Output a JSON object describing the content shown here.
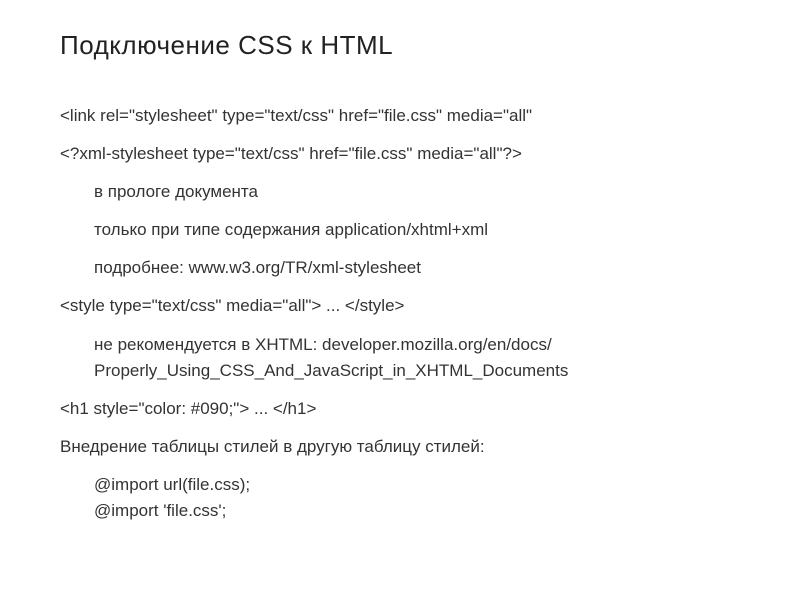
{
  "title": "Подключение CSS к HTML",
  "lines": [
    {
      "text": "<link rel=\"stylesheet\" type=\"text/css\" href=\"file.css\" media=\"all\"",
      "indent": false
    },
    {
      "text": "<?xml-stylesheet type=\"text/css\" href=\"file.css\" media=\"all\"?>",
      "indent": false
    },
    {
      "text": "в прологе документа",
      "indent": true
    },
    {
      "text": "только при типе содержания application/xhtml+xml",
      "indent": true
    },
    {
      "text": "подробнее: www.w3.org/TR/xml-stylesheet",
      "indent": true
    },
    {
      "text": "<style type=\"text/css\" media=\"all\"> ... </style>",
      "indent": false
    },
    {
      "text": "не рекомендуется в XHTML: developer.mozilla.org/en/docs/",
      "indent": true,
      "tight": true
    },
    {
      "text": "Properly_Using_CSS_And_JavaScript_in_XHTML_Documents",
      "indent": true
    },
    {
      "text": "<h1 style=\"color: #090;\"> ... </h1>",
      "indent": false
    },
    {
      "text": "Внедрение таблицы стилей в другую таблицу стилей:",
      "indent": false
    },
    {
      "text": "@import url(file.css);",
      "indent": true,
      "tight": true
    },
    {
      "text": "@import 'file.css';",
      "indent": true
    }
  ]
}
